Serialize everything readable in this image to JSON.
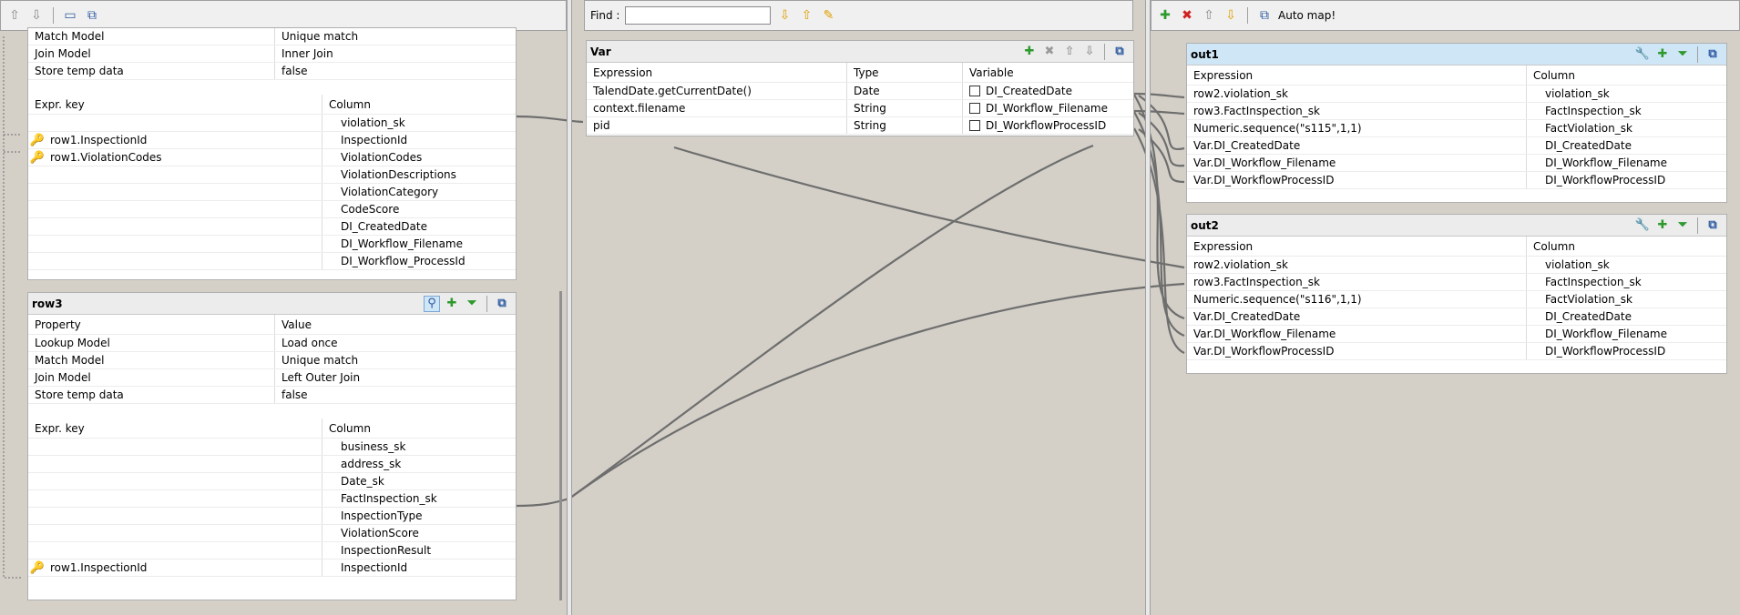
{
  "find": {
    "label": "Find :",
    "value": ""
  },
  "right_toolbar": {
    "automap": "Auto map!"
  },
  "row2_partial": {
    "props": [
      {
        "property": "Match Model",
        "value": "Unique match"
      },
      {
        "property": "Join Model",
        "value": "Inner Join"
      },
      {
        "property": "Store temp data",
        "value": "false"
      }
    ],
    "col_headers": {
      "expr": "Expr. key",
      "column": "Column"
    },
    "rows": [
      {
        "key": "",
        "column": "violation_sk",
        "has_key": false
      },
      {
        "key": "row1.InspectionId",
        "column": "InspectionId",
        "has_key": true
      },
      {
        "key": "row1.ViolationCodes",
        "column": "ViolationCodes",
        "has_key": true
      },
      {
        "key": "",
        "column": "ViolationDescriptions",
        "has_key": false
      },
      {
        "key": "",
        "column": "ViolationCategory",
        "has_key": false
      },
      {
        "key": "",
        "column": "CodeScore",
        "has_key": false
      },
      {
        "key": "",
        "column": "DI_CreatedDate",
        "has_key": false
      },
      {
        "key": "",
        "column": "DI_Workflow_Filename",
        "has_key": false
      },
      {
        "key": "",
        "column": "DI_Workflow_ProcessId",
        "has_key": false
      }
    ]
  },
  "row3": {
    "title": "row3",
    "prop_headers": {
      "property": "Property",
      "value": "Value"
    },
    "props": [
      {
        "property": "Lookup Model",
        "value": "Load once"
      },
      {
        "property": "Match Model",
        "value": "Unique match"
      },
      {
        "property": "Join Model",
        "value": "Left Outer Join"
      },
      {
        "property": "Store temp data",
        "value": "false"
      }
    ],
    "col_headers": {
      "expr": "Expr. key",
      "column": "Column"
    },
    "rows": [
      {
        "key": "",
        "column": "business_sk",
        "has_key": false
      },
      {
        "key": "",
        "column": "address_sk",
        "has_key": false
      },
      {
        "key": "",
        "column": "Date_sk",
        "has_key": false
      },
      {
        "key": "",
        "column": "FactInspection_sk",
        "has_key": false
      },
      {
        "key": "",
        "column": "InspectionType",
        "has_key": false
      },
      {
        "key": "",
        "column": "ViolationScore",
        "has_key": false
      },
      {
        "key": "",
        "column": "InspectionResult",
        "has_key": false
      },
      {
        "key": "row1.InspectionId",
        "column": "InspectionId",
        "has_key": true
      }
    ]
  },
  "var": {
    "title": "Var",
    "headers": {
      "expression": "Expression",
      "type": "Type",
      "variable": "Variable"
    },
    "rows": [
      {
        "expression": "TalendDate.getCurrentDate()",
        "type": "Date",
        "variable": "DI_CreatedDate"
      },
      {
        "expression": "context.filename",
        "type": "String",
        "variable": "DI_Workflow_Filename"
      },
      {
        "expression": "pid",
        "type": "String",
        "variable": "DI_WorkflowProcessID"
      }
    ]
  },
  "out1": {
    "title": "out1",
    "headers": {
      "expression": "Expression",
      "column": "Column"
    },
    "rows": [
      {
        "expression": "row2.violation_sk",
        "column": "violation_sk"
      },
      {
        "expression": "row3.FactInspection_sk",
        "column": "FactInspection_sk"
      },
      {
        "expression": "Numeric.sequence(\"s115\",1,1)",
        "column": "FactViolation_sk"
      },
      {
        "expression": "Var.DI_CreatedDate",
        "column": "DI_CreatedDate"
      },
      {
        "expression": "Var.DI_Workflow_Filename",
        "column": "DI_Workflow_Filename"
      },
      {
        "expression": "Var.DI_WorkflowProcessID",
        "column": "DI_WorkflowProcessID"
      }
    ]
  },
  "out2": {
    "title": "out2",
    "headers": {
      "expression": "Expression",
      "column": "Column"
    },
    "rows": [
      {
        "expression": "row2.violation_sk",
        "column": "violation_sk"
      },
      {
        "expression": "row3.FactInspection_sk",
        "column": "FactInspection_sk"
      },
      {
        "expression": "Numeric.sequence(\"s116\",1,1)",
        "column": "FactViolation_sk"
      },
      {
        "expression": "Var.DI_CreatedDate",
        "column": "DI_CreatedDate"
      },
      {
        "expression": "Var.DI_Workflow_Filename",
        "column": "DI_Workflow_Filename"
      },
      {
        "expression": "Var.DI_WorkflowProcessID",
        "column": "DI_WorkflowProcessID"
      }
    ]
  },
  "colors": {
    "link": "#6e6e6e",
    "selected_title": "#cfe6f7",
    "key_icon": "#8b2f8b"
  }
}
